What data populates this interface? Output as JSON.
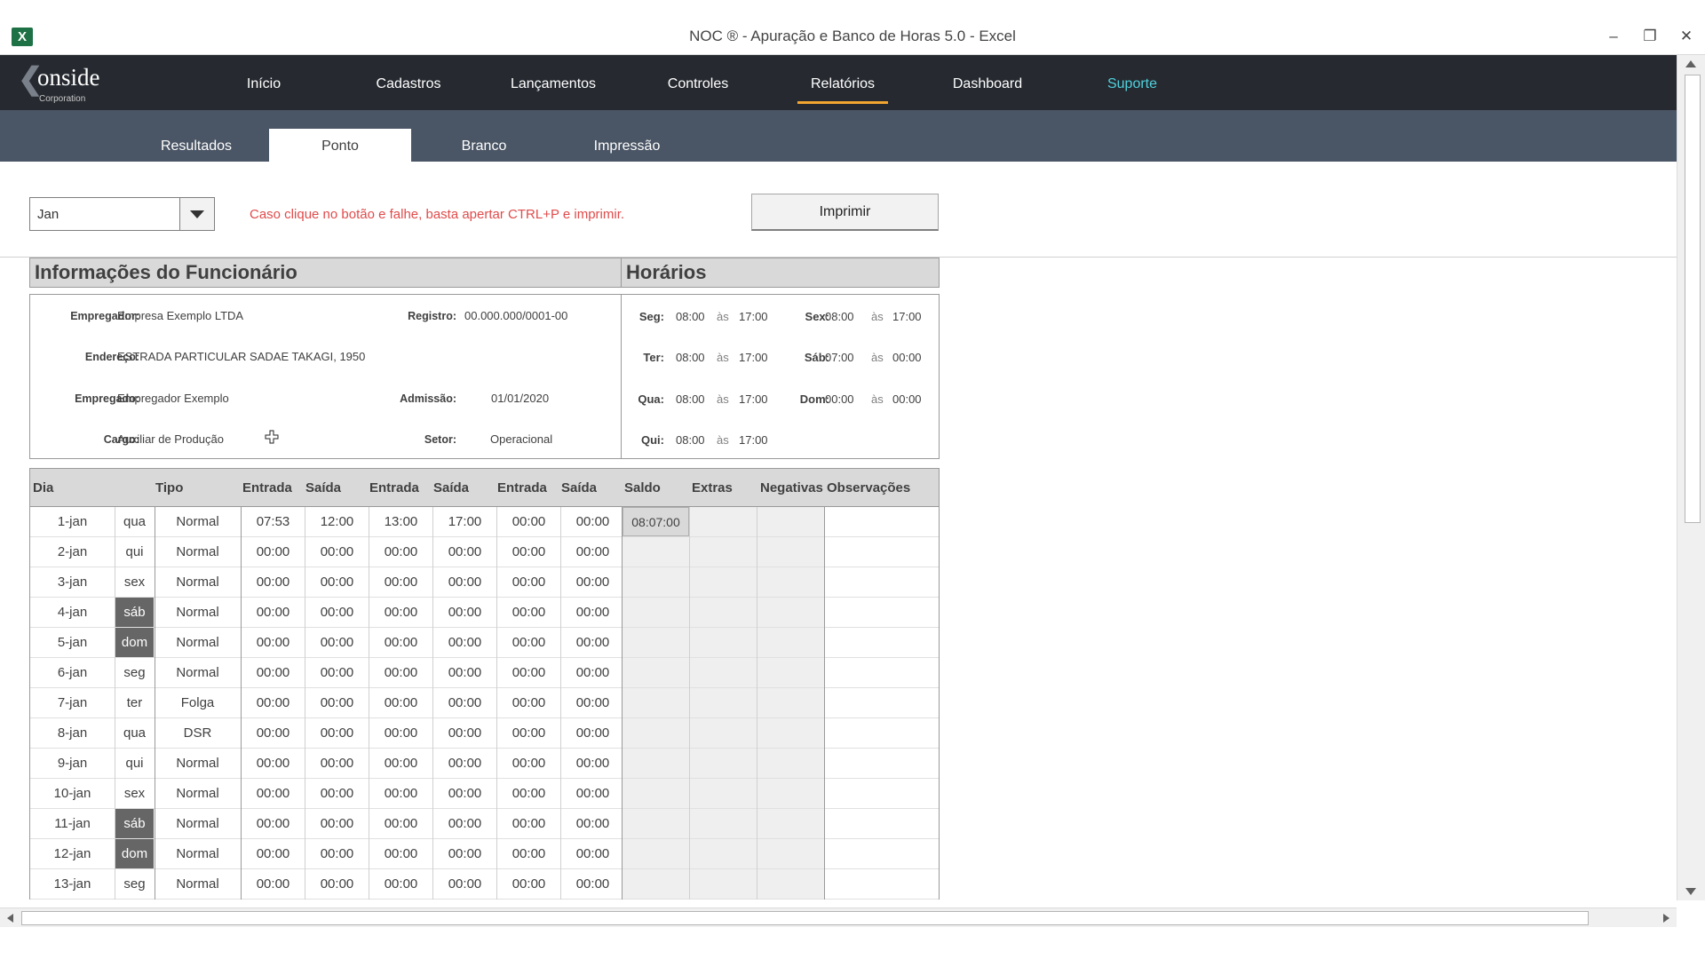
{
  "window": {
    "title": "NOC ® - Apuração e Banco de Horas 5.0 - Excel",
    "app_icon": "excel-icon",
    "app_icon_letter": "X",
    "controls": [
      "minimize-icon",
      "restore-icon",
      "close-icon"
    ],
    "minimize_glyph": "–",
    "restore_glyph": "❐",
    "close_glyph": "✕"
  },
  "logo": {
    "chevron": "❮",
    "text": "onside",
    "sub": "Corporation"
  },
  "nav": {
    "items": [
      {
        "label": "Início"
      },
      {
        "label": "Cadastros"
      },
      {
        "label": "Lançamentos"
      },
      {
        "label": "Controles"
      },
      {
        "label": "Relatórios"
      },
      {
        "label": "Dashboard"
      },
      {
        "label": "Suporte"
      }
    ],
    "active": "Relatórios",
    "active_color": "#f2a52f",
    "support_color": "#4fd0dd"
  },
  "subnav": {
    "tabs": [
      {
        "label": "Resultados"
      },
      {
        "label": "Ponto"
      },
      {
        "label": "Branco"
      },
      {
        "label": "Impressão"
      }
    ],
    "active": "Ponto"
  },
  "controls": {
    "month_value": "Jan",
    "warning": "Caso clique no botão e falhe, basta apertar CTRL+P e imprimir.",
    "warning_color": "#e04b4b",
    "print_label": "Imprimir"
  },
  "employee": {
    "title": "Informações do Funcionário",
    "empregador_label": "Empregador:",
    "empregador": "Empresa Exemplo LTDA",
    "registro_label": "Registro:",
    "registro": "00.000.000/0001-00",
    "endereco_label": "Endereço:",
    "endereco": "ESTRADA PARTICULAR SADAE TAKAGI, 1950",
    "empregado_label": "Empregado:",
    "empregado": "Empregador Exemplo",
    "admissao_label": "Admissão:",
    "admissao": "01/01/2020",
    "cargo_label": "Cargo:",
    "cargo": "Auxiliar de Produção",
    "setor_label": "Setor:",
    "setor": "Operacional"
  },
  "schedule": {
    "title": "Horários",
    "as": "às",
    "left": [
      {
        "day": "Seg:",
        "start": "08:00",
        "end": "17:00"
      },
      {
        "day": "Ter:",
        "start": "08:00",
        "end": "17:00"
      },
      {
        "day": "Qua:",
        "start": "08:00",
        "end": "17:00"
      },
      {
        "day": "Qui:",
        "start": "08:00",
        "end": "17:00"
      }
    ],
    "right": [
      {
        "day": "Sex:",
        "start": "08:00",
        "end": "17:00"
      },
      {
        "day": "Sáb:",
        "start": "07:00",
        "end": "00:00"
      },
      {
        "day": "Dom:",
        "start": "00:00",
        "end": "00:00"
      }
    ]
  },
  "table": {
    "headers": [
      "Dia",
      "Tipo",
      "Entrada",
      "Saída",
      "Entrada",
      "Saída",
      "Entrada",
      "Saída",
      "Saldo",
      "Extras",
      "Negativas",
      "Observações"
    ],
    "rows": [
      {
        "date": "1-jan",
        "wd": "qua",
        "weekend": false,
        "tipo": "Normal",
        "times": [
          "07:53",
          "12:00",
          "13:00",
          "17:00",
          "00:00",
          "00:00"
        ],
        "saldo": "08:07:00"
      },
      {
        "date": "2-jan",
        "wd": "qui",
        "weekend": false,
        "tipo": "Normal",
        "times": [
          "00:00",
          "00:00",
          "00:00",
          "00:00",
          "00:00",
          "00:00"
        ],
        "saldo": ""
      },
      {
        "date": "3-jan",
        "wd": "sex",
        "weekend": false,
        "tipo": "Normal",
        "times": [
          "00:00",
          "00:00",
          "00:00",
          "00:00",
          "00:00",
          "00:00"
        ],
        "saldo": ""
      },
      {
        "date": "4-jan",
        "wd": "sáb",
        "weekend": true,
        "tipo": "Normal",
        "times": [
          "00:00",
          "00:00",
          "00:00",
          "00:00",
          "00:00",
          "00:00"
        ],
        "saldo": ""
      },
      {
        "date": "5-jan",
        "wd": "dom",
        "weekend": true,
        "tipo": "Normal",
        "times": [
          "00:00",
          "00:00",
          "00:00",
          "00:00",
          "00:00",
          "00:00"
        ],
        "saldo": ""
      },
      {
        "date": "6-jan",
        "wd": "seg",
        "weekend": false,
        "tipo": "Normal",
        "times": [
          "00:00",
          "00:00",
          "00:00",
          "00:00",
          "00:00",
          "00:00"
        ],
        "saldo": ""
      },
      {
        "date": "7-jan",
        "wd": "ter",
        "weekend": false,
        "tipo": "Folga",
        "times": [
          "00:00",
          "00:00",
          "00:00",
          "00:00",
          "00:00",
          "00:00"
        ],
        "saldo": ""
      },
      {
        "date": "8-jan",
        "wd": "qua",
        "weekend": false,
        "tipo": "DSR",
        "times": [
          "00:00",
          "00:00",
          "00:00",
          "00:00",
          "00:00",
          "00:00"
        ],
        "saldo": ""
      },
      {
        "date": "9-jan",
        "wd": "qui",
        "weekend": false,
        "tipo": "Normal",
        "times": [
          "00:00",
          "00:00",
          "00:00",
          "00:00",
          "00:00",
          "00:00"
        ],
        "saldo": ""
      },
      {
        "date": "10-jan",
        "wd": "sex",
        "weekend": false,
        "tipo": "Normal",
        "times": [
          "00:00",
          "00:00",
          "00:00",
          "00:00",
          "00:00",
          "00:00"
        ],
        "saldo": ""
      },
      {
        "date": "11-jan",
        "wd": "sáb",
        "weekend": true,
        "tipo": "Normal",
        "times": [
          "00:00",
          "00:00",
          "00:00",
          "00:00",
          "00:00",
          "00:00"
        ],
        "saldo": ""
      },
      {
        "date": "12-jan",
        "wd": "dom",
        "weekend": true,
        "tipo": "Normal",
        "times": [
          "00:00",
          "00:00",
          "00:00",
          "00:00",
          "00:00",
          "00:00"
        ],
        "saldo": ""
      },
      {
        "date": "13-jan",
        "wd": "seg",
        "weekend": false,
        "tipo": "Normal",
        "times": [
          "00:00",
          "00:00",
          "00:00",
          "00:00",
          "00:00",
          "00:00"
        ],
        "saldo": ""
      }
    ]
  }
}
